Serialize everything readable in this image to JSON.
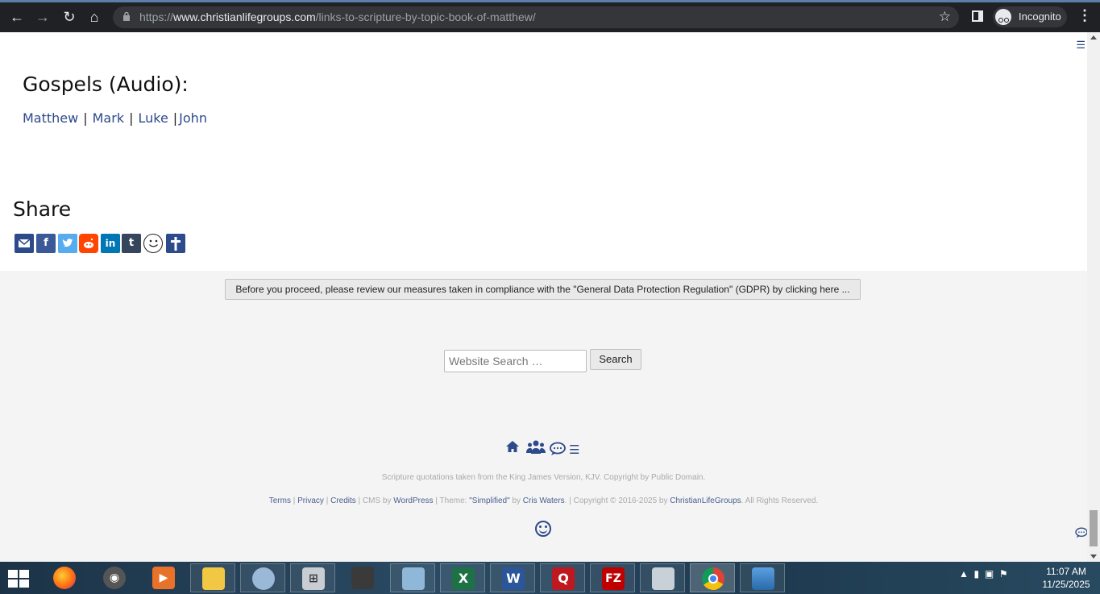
{
  "browser": {
    "url_prefix": "https://",
    "url_domain": "www.christianlifegroups.com",
    "url_path": "/links-to-scripture-by-topic-book-of-matthew/",
    "incognito_label": "Incognito"
  },
  "content": {
    "gospels_heading": "Gospels (Audio):",
    "gospel_links": [
      {
        "label": "Matthew"
      },
      {
        "label": "Mark"
      },
      {
        "label": "Luke"
      },
      {
        "label": "John"
      }
    ],
    "separator": "|",
    "share_heading": "Share",
    "share_icons": [
      {
        "name": "email-icon",
        "color": "#2d4a8a"
      },
      {
        "name": "facebook-icon",
        "color": "#3b5998"
      },
      {
        "name": "twitter-icon",
        "color": "#55acee"
      },
      {
        "name": "reddit-icon",
        "color": "#ff4500"
      },
      {
        "name": "linkedin-icon",
        "color": "#0077b5"
      },
      {
        "name": "tumblr-icon",
        "color": "#35465c"
      },
      {
        "name": "smiley-icon",
        "color": "#ffffff"
      },
      {
        "name": "cross-icon",
        "color": "#2d4a8a"
      }
    ]
  },
  "gdpr": {
    "button_label": "Before you proceed, please review our measures taken in compliance with the \"General Data Protection Regulation\" (GDPR) by clicking here ..."
  },
  "search": {
    "placeholder": "Website Search …",
    "button_label": "Search"
  },
  "footer": {
    "icons": [
      "home-icon",
      "group-icon",
      "chat-icon",
      "menu-icon"
    ],
    "scripture_note": "Scripture quotations taken from the King James Version, KJV. Copyright by Public Domain.",
    "links": {
      "terms": "Terms",
      "privacy": "Privacy",
      "credits": "Credits",
      "cms_by": "CMS by",
      "wordpress": "WordPress",
      "theme": "Theme:",
      "simplified": "\"Simplified\"",
      "by": "by",
      "author": "Cris Waters",
      "copyright": "Copyright © 2016-2025 by",
      "site": "ChristianLifeGroups",
      "rights": "All Rights Reserved."
    }
  },
  "taskbar": {
    "clock_time": "11:07 AM",
    "clock_date": "11/25/2025",
    "apps": [
      "firefox",
      "media",
      "player",
      "file-explorer",
      "paint",
      "calculator",
      "scanner",
      "notepad",
      "excel",
      "word",
      "q-app",
      "filezilla",
      "monitor",
      "chrome",
      "photos"
    ]
  }
}
